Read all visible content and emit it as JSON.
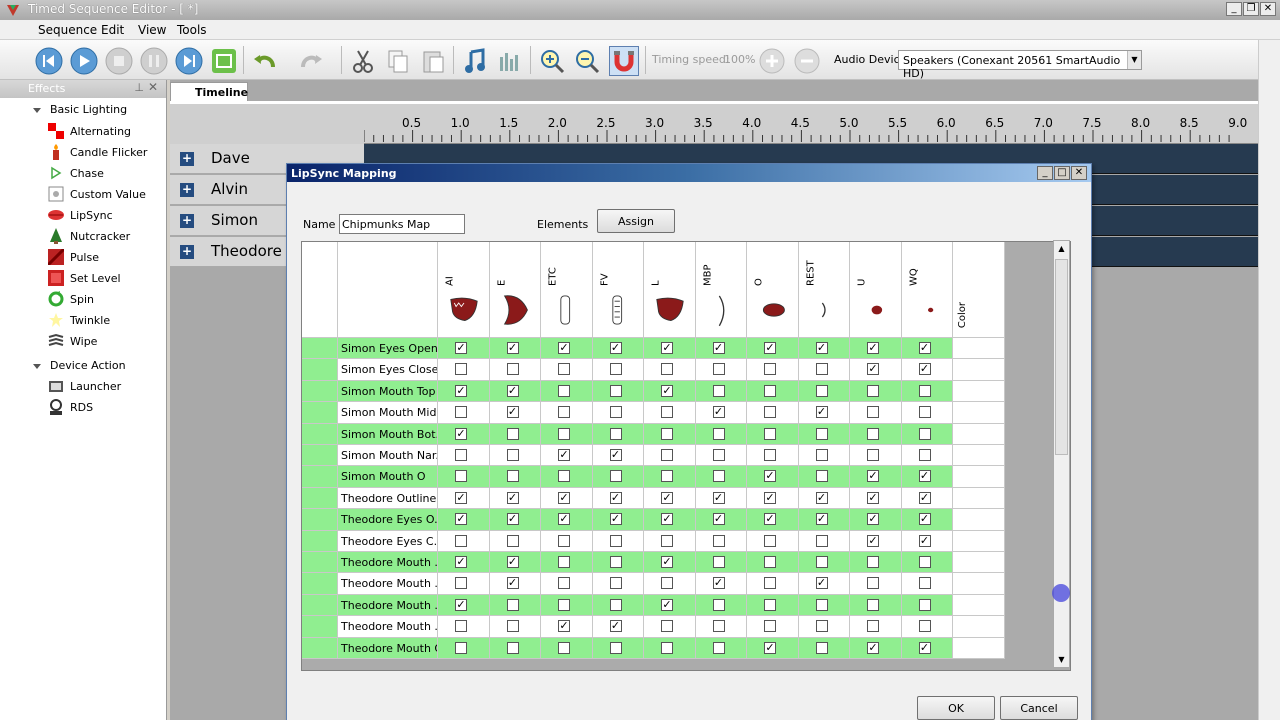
{
  "window": {
    "title": "Timed Sequence Editor - [ *]"
  },
  "menu": [
    "Sequence",
    "Edit",
    "View",
    "Tools"
  ],
  "toolbar": {
    "timing_label": "Timing speed:",
    "timing_value": "100%",
    "audio_label": "Audio Device",
    "audio_device": "Speakers (Conexant 20561 SmartAudio HD)"
  },
  "effects": {
    "header": "Effects",
    "groups": [
      {
        "label": "Basic Lighting",
        "items": [
          "Alternating",
          "Candle Flicker",
          "Chase",
          "Custom Value",
          "LipSync",
          "Nutcracker",
          "Pulse",
          "Set Level",
          "Spin",
          "Twinkle",
          "Wipe"
        ]
      },
      {
        "label": "Device Action",
        "items": [
          "Launcher",
          "RDS"
        ]
      }
    ]
  },
  "timeline": {
    "tab": "Timeline",
    "ruler": [
      "0.5",
      "1.0",
      "1.5",
      "2.0",
      "2.5",
      "3.0",
      "3.5",
      "4.0",
      "4.5",
      "5.0",
      "5.5",
      "6.0",
      "6.5",
      "7.0",
      "7.5",
      "8.0",
      "8.5",
      "9.0"
    ],
    "rows": [
      "Dave",
      "Alvin",
      "Simon",
      "Theodore"
    ]
  },
  "dialog": {
    "title": "LipSync Mapping",
    "name_label": "Name",
    "name_value": "Chipmunks Map",
    "elements_label": "Elements",
    "assign_label": "Assign",
    "ok_label": "OK",
    "cancel_label": "Cancel",
    "color_label": "Color",
    "phonemes": [
      "AI",
      "E",
      "ETC",
      "FV",
      "L",
      "MBP",
      "O",
      "REST",
      "U",
      "WQ"
    ],
    "rows": [
      {
        "name": "Simon Eyes Open",
        "checks": [
          1,
          1,
          1,
          1,
          1,
          1,
          1,
          1,
          1,
          1
        ]
      },
      {
        "name": "Simon Eyes Closed",
        "checks": [
          0,
          0,
          0,
          0,
          0,
          0,
          0,
          0,
          1,
          1
        ]
      },
      {
        "name": "Simon Mouth Top",
        "checks": [
          1,
          1,
          0,
          0,
          1,
          0,
          0,
          0,
          0,
          0
        ]
      },
      {
        "name": "Simon Mouth Mid...",
        "checks": [
          0,
          1,
          0,
          0,
          0,
          1,
          0,
          1,
          0,
          0
        ]
      },
      {
        "name": "Simon Mouth Bot...",
        "checks": [
          1,
          0,
          0,
          0,
          0,
          0,
          0,
          0,
          0,
          0
        ]
      },
      {
        "name": "Simon Mouth Nar...",
        "checks": [
          0,
          0,
          1,
          1,
          0,
          0,
          0,
          0,
          0,
          0
        ]
      },
      {
        "name": "Simon Mouth O",
        "checks": [
          0,
          0,
          0,
          0,
          0,
          0,
          1,
          0,
          1,
          1
        ]
      },
      {
        "name": "Theodore Outline",
        "checks": [
          1,
          1,
          1,
          1,
          1,
          1,
          1,
          1,
          1,
          1
        ]
      },
      {
        "name": "Theodore Eyes O...",
        "checks": [
          1,
          1,
          1,
          1,
          1,
          1,
          1,
          1,
          1,
          1
        ]
      },
      {
        "name": "Theodore Eyes C...",
        "checks": [
          0,
          0,
          0,
          0,
          0,
          0,
          0,
          0,
          1,
          1
        ]
      },
      {
        "name": "Theodore Mouth ...",
        "checks": [
          1,
          1,
          0,
          0,
          1,
          0,
          0,
          0,
          0,
          0
        ]
      },
      {
        "name": "Theodore Mouth ...",
        "checks": [
          0,
          1,
          0,
          0,
          0,
          1,
          0,
          1,
          0,
          0
        ]
      },
      {
        "name": "Theodore Mouth ...",
        "checks": [
          1,
          0,
          0,
          0,
          1,
          0,
          0,
          0,
          0,
          0
        ]
      },
      {
        "name": "Theodore Mouth ...",
        "checks": [
          0,
          0,
          1,
          1,
          0,
          0,
          0,
          0,
          0,
          0
        ]
      },
      {
        "name": "Theodore Mouth O",
        "checks": [
          0,
          0,
          0,
          0,
          0,
          0,
          1,
          0,
          1,
          1
        ]
      }
    ]
  },
  "colors": {
    "row_green": "#90ee90",
    "timeline_row": "#263a50",
    "title_blue": "#0a246a"
  }
}
